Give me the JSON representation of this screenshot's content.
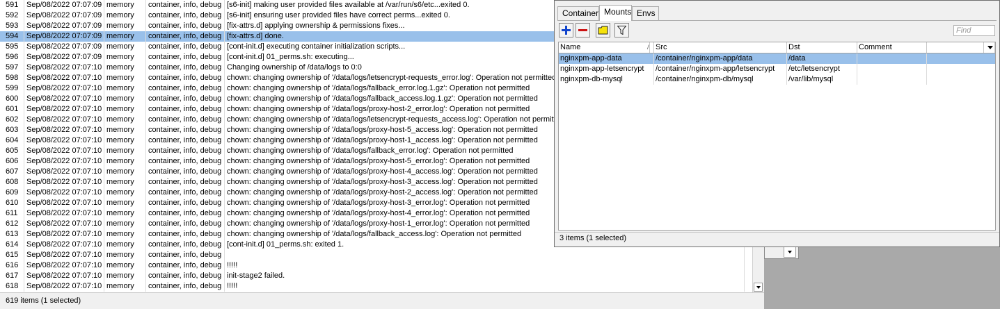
{
  "log": {
    "rows": [
      {
        "num": "591",
        "time": "Sep/08/2022 07:07:09",
        "buffer": "memory",
        "topics": "container, info, debug",
        "message": "[s6-init] making user provided files available at /var/run/s6/etc...exited 0."
      },
      {
        "num": "592",
        "time": "Sep/08/2022 07:07:09",
        "buffer": "memory",
        "topics": "container, info, debug",
        "message": "[s6-init] ensuring user provided files have correct perms...exited 0."
      },
      {
        "num": "593",
        "time": "Sep/08/2022 07:07:09",
        "buffer": "memory",
        "topics": "container, info, debug",
        "message": "[fix-attrs.d] applying ownership & permissions fixes..."
      },
      {
        "num": "594",
        "time": "Sep/08/2022 07:07:09",
        "buffer": "memory",
        "topics": "container, info, debug",
        "message": "[fix-attrs.d] done."
      },
      {
        "num": "595",
        "time": "Sep/08/2022 07:07:09",
        "buffer": "memory",
        "topics": "container, info, debug",
        "message": "[cont-init.d] executing container initialization scripts..."
      },
      {
        "num": "596",
        "time": "Sep/08/2022 07:07:09",
        "buffer": "memory",
        "topics": "container, info, debug",
        "message": "[cont-init.d] 01_perms.sh: executing..."
      },
      {
        "num": "597",
        "time": "Sep/08/2022 07:07:10",
        "buffer": "memory",
        "topics": "container, info, debug",
        "message": "Changing ownership of /data/logs to 0:0"
      },
      {
        "num": "598",
        "time": "Sep/08/2022 07:07:10",
        "buffer": "memory",
        "topics": "container, info, debug",
        "message": "chown: changing ownership of '/data/logs/letsencrypt-requests_error.log': Operation not permitted"
      },
      {
        "num": "599",
        "time": "Sep/08/2022 07:07:10",
        "buffer": "memory",
        "topics": "container, info, debug",
        "message": "chown: changing ownership of '/data/logs/fallback_error.log.1.gz': Operation not permitted"
      },
      {
        "num": "600",
        "time": "Sep/08/2022 07:07:10",
        "buffer": "memory",
        "topics": "container, info, debug",
        "message": "chown: changing ownership of '/data/logs/fallback_access.log.1.gz': Operation not permitted"
      },
      {
        "num": "601",
        "time": "Sep/08/2022 07:07:10",
        "buffer": "memory",
        "topics": "container, info, debug",
        "message": "chown: changing ownership of '/data/logs/proxy-host-2_error.log': Operation not permitted"
      },
      {
        "num": "602",
        "time": "Sep/08/2022 07:07:10",
        "buffer": "memory",
        "topics": "container, info, debug",
        "message": "chown: changing ownership of '/data/logs/letsencrypt-requests_access.log': Operation not permitted"
      },
      {
        "num": "603",
        "time": "Sep/08/2022 07:07:10",
        "buffer": "memory",
        "topics": "container, info, debug",
        "message": "chown: changing ownership of '/data/logs/proxy-host-5_access.log': Operation not permitted"
      },
      {
        "num": "604",
        "time": "Sep/08/2022 07:07:10",
        "buffer": "memory",
        "topics": "container, info, debug",
        "message": "chown: changing ownership of '/data/logs/proxy-host-1_access.log': Operation not permitted"
      },
      {
        "num": "605",
        "time": "Sep/08/2022 07:07:10",
        "buffer": "memory",
        "topics": "container, info, debug",
        "message": "chown: changing ownership of '/data/logs/fallback_error.log': Operation not permitted"
      },
      {
        "num": "606",
        "time": "Sep/08/2022 07:07:10",
        "buffer": "memory",
        "topics": "container, info, debug",
        "message": "chown: changing ownership of '/data/logs/proxy-host-5_error.log': Operation not permitted"
      },
      {
        "num": "607",
        "time": "Sep/08/2022 07:07:10",
        "buffer": "memory",
        "topics": "container, info, debug",
        "message": "chown: changing ownership of '/data/logs/proxy-host-4_access.log': Operation not permitted"
      },
      {
        "num": "608",
        "time": "Sep/08/2022 07:07:10",
        "buffer": "memory",
        "topics": "container, info, debug",
        "message": "chown: changing ownership of '/data/logs/proxy-host-3_access.log': Operation not permitted"
      },
      {
        "num": "609",
        "time": "Sep/08/2022 07:07:10",
        "buffer": "memory",
        "topics": "container, info, debug",
        "message": "chown: changing ownership of '/data/logs/proxy-host-2_access.log': Operation not permitted"
      },
      {
        "num": "610",
        "time": "Sep/08/2022 07:07:10",
        "buffer": "memory",
        "topics": "container, info, debug",
        "message": "chown: changing ownership of '/data/logs/proxy-host-3_error.log': Operation not permitted"
      },
      {
        "num": "611",
        "time": "Sep/08/2022 07:07:10",
        "buffer": "memory",
        "topics": "container, info, debug",
        "message": "chown: changing ownership of '/data/logs/proxy-host-4_error.log': Operation not permitted"
      },
      {
        "num": "612",
        "time": "Sep/08/2022 07:07:10",
        "buffer": "memory",
        "topics": "container, info, debug",
        "message": "chown: changing ownership of '/data/logs/proxy-host-1_error.log': Operation not permitted"
      },
      {
        "num": "613",
        "time": "Sep/08/2022 07:07:10",
        "buffer": "memory",
        "topics": "container, info, debug",
        "message": "chown: changing ownership of '/data/logs/fallback_access.log': Operation not permitted"
      },
      {
        "num": "614",
        "time": "Sep/08/2022 07:07:10",
        "buffer": "memory",
        "topics": "container, info, debug",
        "message": "[cont-init.d] 01_perms.sh: exited 1."
      },
      {
        "num": "615",
        "time": "Sep/08/2022 07:07:10",
        "buffer": "memory",
        "topics": "container, info, debug",
        "message": ""
      },
      {
        "num": "616",
        "time": "Sep/08/2022 07:07:10",
        "buffer": "memory",
        "topics": "container, info, debug",
        "message": "!!!!!"
      },
      {
        "num": "617",
        "time": "Sep/08/2022 07:07:10",
        "buffer": "memory",
        "topics": "container, info, debug",
        "message": " init-stage2 failed."
      },
      {
        "num": "618",
        "time": "Sep/08/2022 07:07:10",
        "buffer": "memory",
        "topics": "container, info, debug",
        "message": "!!!!!"
      }
    ],
    "selected_num": "594",
    "status": "619 items (1 selected)"
  },
  "window": {
    "tabs": [
      {
        "label": "Container",
        "active": false
      },
      {
        "label": "Mounts",
        "active": true
      },
      {
        "label": "Envs",
        "active": false
      }
    ],
    "toolbar": {
      "add_icon": "plus-icon",
      "remove_icon": "minus-icon",
      "comment_icon": "comment-icon",
      "filter_icon": "filter-icon"
    },
    "find_placeholder": "Find",
    "columns": {
      "name": "Name",
      "src": "Src",
      "dst": "Dst",
      "comment": "Comment"
    },
    "mounts": [
      {
        "name": "nginxpm-app-data",
        "src": "/container/nginxpm-app/data",
        "dst": "/data",
        "comment": "",
        "selected": true
      },
      {
        "name": "nginxpm-app-letsencrypt",
        "src": "/container/nginxpm-app/letsencrypt",
        "dst": "/etc/letsencrypt",
        "comment": "",
        "selected": false
      },
      {
        "name": "nginxpm-db-mysql",
        "src": "/container/nginxpm-db/mysql",
        "dst": "/var/lib/mysql",
        "comment": "",
        "selected": false
      }
    ],
    "status": "3 items (1 selected)"
  },
  "colors": {
    "selection": "#99c0ea",
    "add": "#1144cc",
    "remove": "#cc1111",
    "comment": "#f5e20a"
  }
}
